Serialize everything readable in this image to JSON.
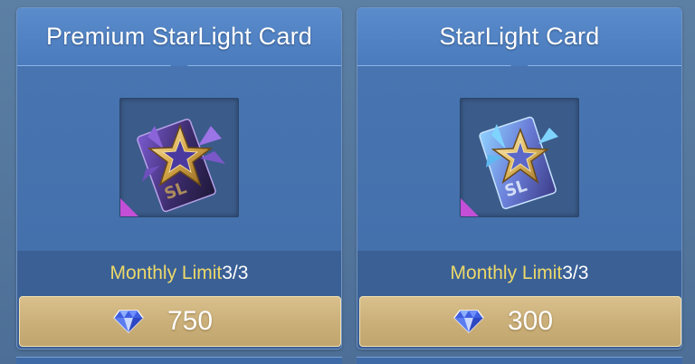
{
  "cards": [
    {
      "title": "Premium StarLight Card",
      "item_icon": "premium-starlight-card-icon",
      "monthly_limit_label": "Monthly Limit",
      "monthly_limit_value": "3/3",
      "price": "750",
      "currency_icon": "diamond-icon"
    },
    {
      "title": "StarLight Card",
      "item_icon": "starlight-card-icon",
      "monthly_limit_label": "Monthly Limit",
      "monthly_limit_value": "3/3",
      "price": "300",
      "currency_icon": "diamond-icon"
    }
  ],
  "colors": {
    "background": "#5c7fa4",
    "card_body": "#4875b1",
    "limit_label": "#ecd86a",
    "price_bar": "#cbb07a"
  }
}
